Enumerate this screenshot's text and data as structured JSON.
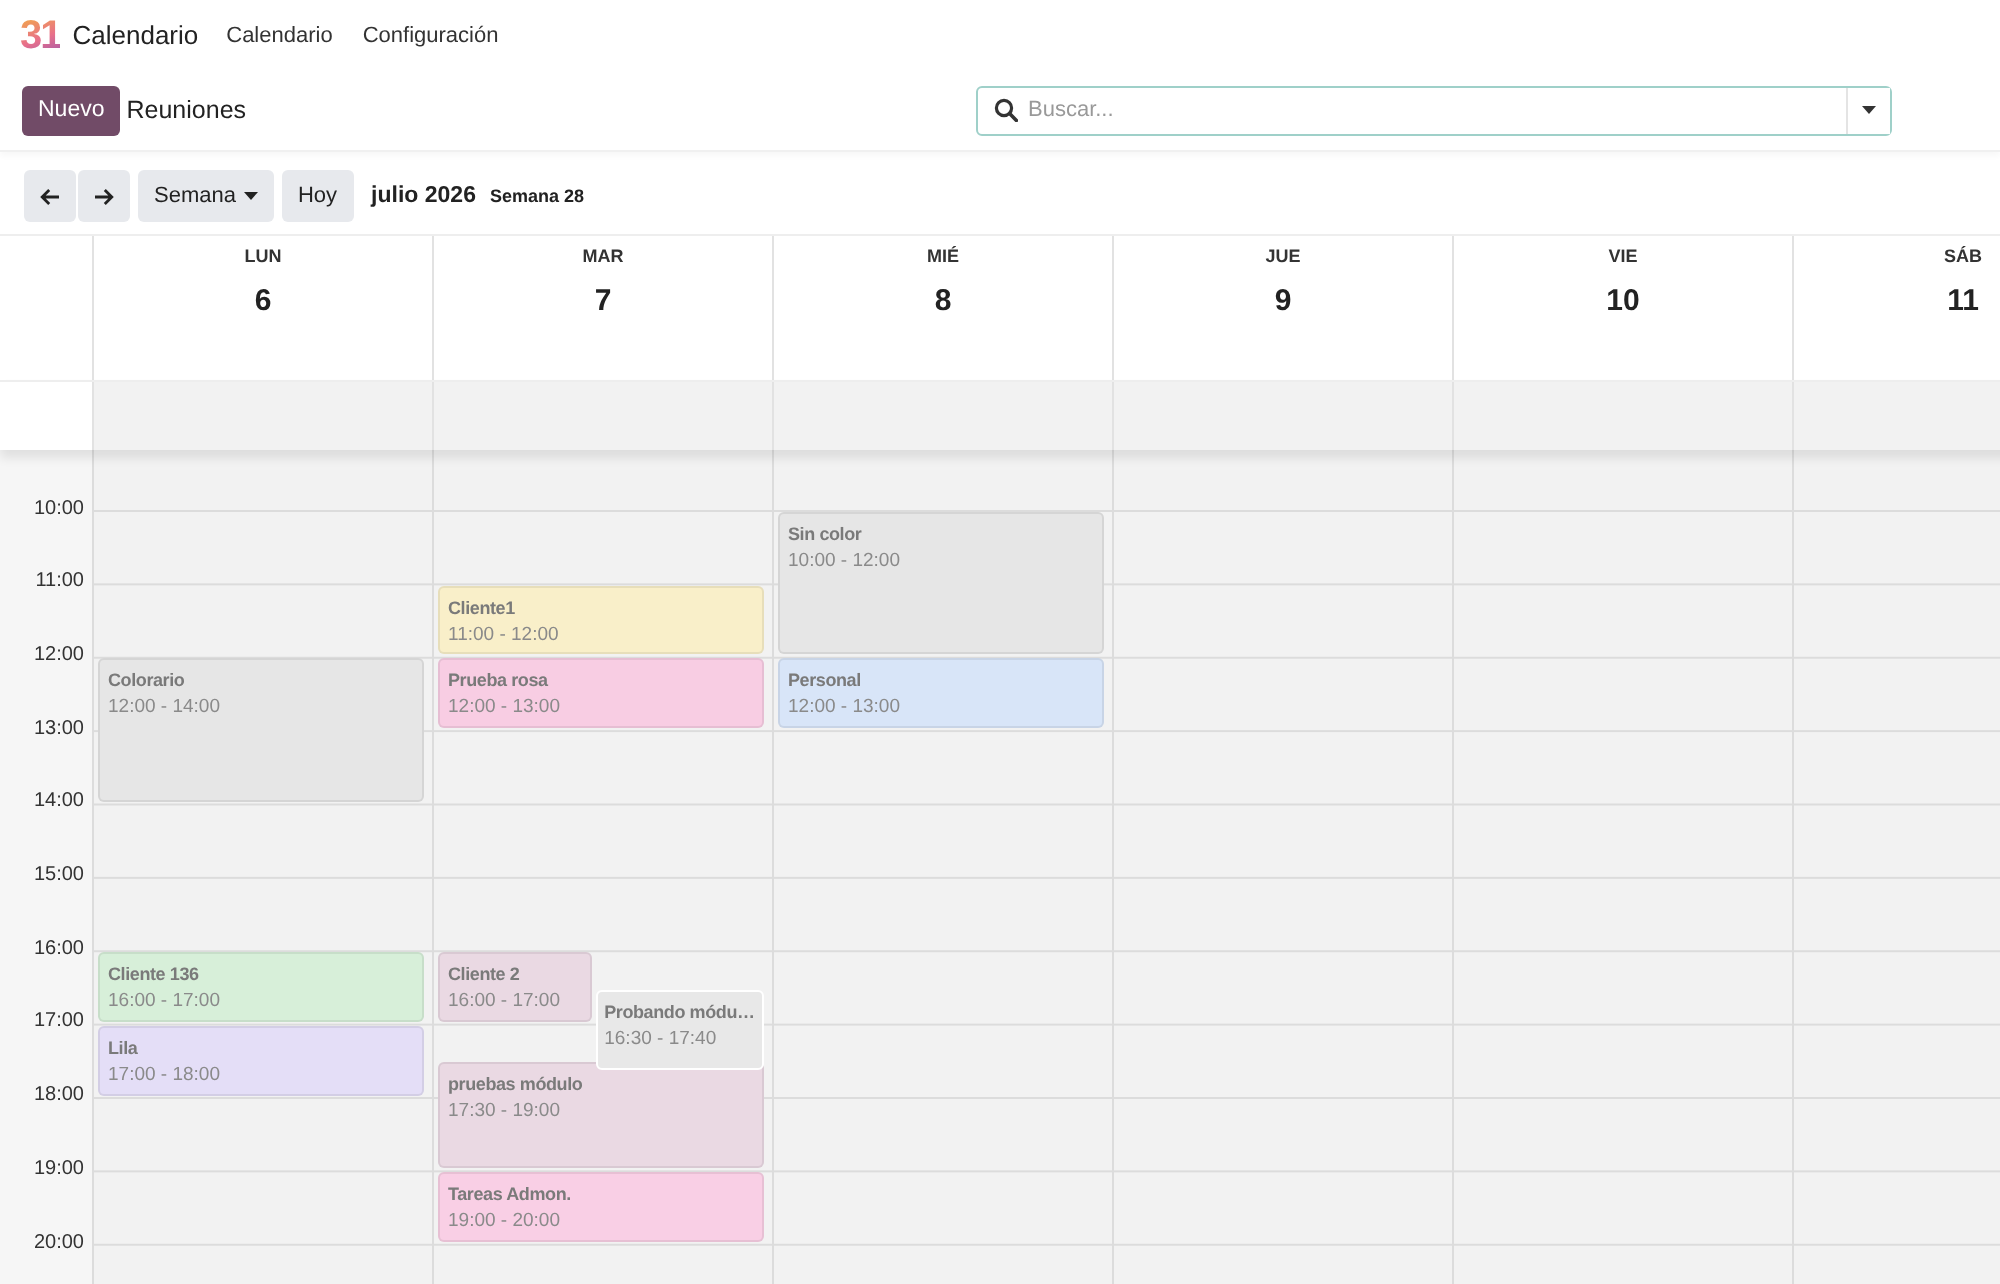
{
  "navbar": {
    "logo": "31",
    "app_name": "Calendario",
    "menu": [
      "Calendario",
      "Configuración"
    ]
  },
  "control_panel": {
    "new_button": "Nuevo",
    "breadcrumb": "Reuniones",
    "search": {
      "placeholder": "Buscar..."
    }
  },
  "toolbar": {
    "scale": "Semana",
    "today": "Hoy",
    "period": "julio 2026",
    "week": "Semana 28"
  },
  "calendar": {
    "hours": [
      "10:00",
      "11:00",
      "12:00",
      "13:00",
      "14:00",
      "15:00",
      "16:00",
      "17:00",
      "18:00",
      "19:00",
      "20:00"
    ],
    "days": [
      {
        "name": "LUN",
        "number": "6",
        "events": [
          {
            "title": "Colorario",
            "time": "12:00 - 14:00",
            "color": "#e6e6e6"
          },
          {
            "title": "Cliente 136",
            "time": "16:00 - 17:00",
            "color": "#d7efd9"
          },
          {
            "title": "Lila",
            "time": "17:00 - 18:00",
            "color": "#e4def7"
          }
        ]
      },
      {
        "name": "MAR",
        "number": "7",
        "events": [
          {
            "title": "Cliente1",
            "time": "11:00 - 12:00",
            "color": "#f9efc9"
          },
          {
            "title": "Prueba rosa",
            "time": "12:00 - 13:00",
            "color": "#f8cde3"
          },
          {
            "title": "Cliente 2",
            "time": "16:00 - 17:00",
            "color": "#ead9e3"
          },
          {
            "title": "Probando módu…",
            "time": "16:30 - 17:40",
            "color": "#e8e8e8"
          },
          {
            "title": "pruebas módulo",
            "time": "17:30 - 19:00",
            "color": "#ead9e3"
          },
          {
            "title": "Tareas Admon.",
            "time": "19:00 - 20:00",
            "color": "#f9cfe5"
          }
        ]
      },
      {
        "name": "MIÉ",
        "number": "8",
        "events": [
          {
            "title": "Sin color",
            "time": "10:00 - 12:00",
            "color": "#e6e6e6"
          },
          {
            "title": "Personal",
            "time": "12:00 - 13:00",
            "color": "#d8e5f8"
          }
        ]
      },
      {
        "name": "JUE",
        "number": "9"
      },
      {
        "name": "VIE",
        "number": "10"
      },
      {
        "name": "SÁB",
        "number": "11"
      }
    ]
  }
}
